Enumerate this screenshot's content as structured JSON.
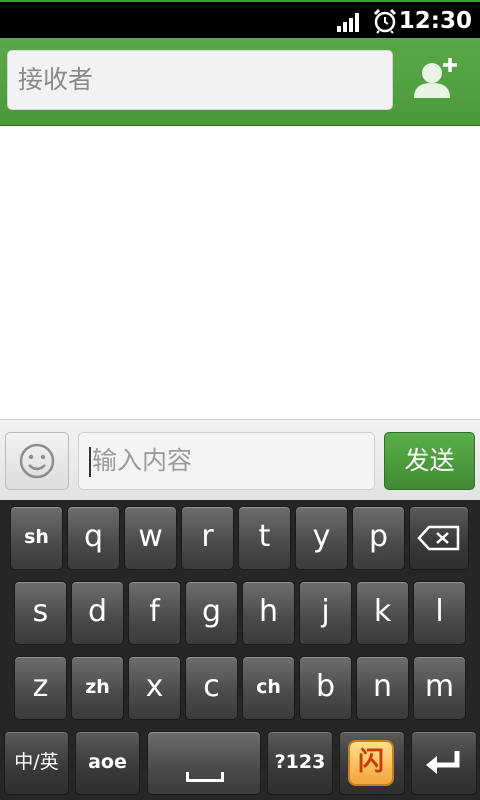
{
  "status_bar": {
    "time": "12:30",
    "icons": [
      "signal-icon",
      "alarm-clock-icon"
    ]
  },
  "header": {
    "recipient_placeholder": "接收者",
    "add_contact_icon": "add-contact-icon",
    "accent_color": "#4a9a3c"
  },
  "compose": {
    "emoji_icon": "smiley-icon",
    "message_placeholder": "输入内容",
    "send_label": "发送"
  },
  "keyboard": {
    "row1": [
      "sh",
      "q",
      "w",
      "r",
      "t",
      "y",
      "p"
    ],
    "row2": [
      "s",
      "d",
      "f",
      "g",
      "h",
      "j",
      "k",
      "l"
    ],
    "row3": [
      "z",
      "zh",
      "x",
      "c",
      "ch",
      "b",
      "n",
      "m"
    ],
    "row4": [
      "中/英",
      "aoe",
      "?123",
      "闪"
    ],
    "icons": [
      "backspace-icon",
      "space-icon",
      "enter-icon"
    ]
  }
}
